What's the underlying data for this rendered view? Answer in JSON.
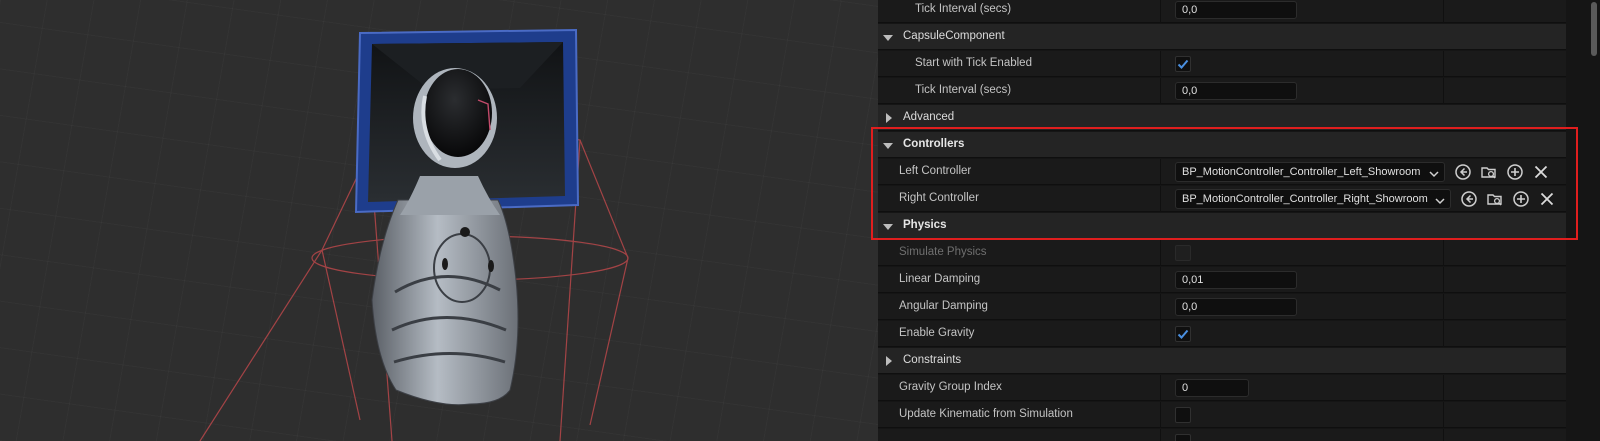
{
  "details": {
    "rows": [
      {
        "id": "tick-interval-1",
        "label": "Tick Interval (secs)",
        "type": "number",
        "value": "0,0"
      },
      {
        "id": "capsule",
        "label": "CapsuleComponent",
        "type": "category",
        "expanded": true
      },
      {
        "id": "start-tick",
        "label": "Start with Tick Enabled",
        "type": "checkbox",
        "checked": true
      },
      {
        "id": "tick-interval-2",
        "label": "Tick Interval (secs)",
        "type": "number",
        "value": "0,0"
      },
      {
        "id": "advanced",
        "label": "Advanced",
        "type": "category",
        "expanded": false
      },
      {
        "id": "controllers",
        "label": "Controllers",
        "type": "category",
        "expanded": true
      },
      {
        "id": "left-controller",
        "label": "Left Controller",
        "type": "asset",
        "value": "BP_MotionController_Controller_Left_Showroom"
      },
      {
        "id": "right-controller",
        "label": "Right Controller",
        "type": "asset",
        "value": "BP_MotionController_Controller_Right_Showroom"
      },
      {
        "id": "physics",
        "label": "Physics",
        "type": "category",
        "expanded": true
      },
      {
        "id": "simulate-physics",
        "label": "Simulate Physics",
        "type": "checkbox",
        "checked": false,
        "disabled": true
      },
      {
        "id": "linear-damping",
        "label": "Linear Damping",
        "type": "number",
        "value": "0,01"
      },
      {
        "id": "angular-damping",
        "label": "Angular Damping",
        "type": "number",
        "value": "0,0"
      },
      {
        "id": "enable-gravity",
        "label": "Enable Gravity",
        "type": "checkbox",
        "checked": true
      },
      {
        "id": "constraints",
        "label": "Constraints",
        "type": "category",
        "expanded": false
      },
      {
        "id": "gravity-group",
        "label": "Gravity Group Index",
        "type": "number",
        "value": "0"
      },
      {
        "id": "update-kinematic",
        "label": "Update Kinematic from Simulation",
        "type": "checkbox",
        "checked": false
      },
      {
        "id": "partial-row",
        "label": "",
        "type": "checkbox",
        "checked": false
      }
    ]
  },
  "icons": {
    "browse": "browse-asset-icon",
    "find": "find-in-content-browser-icon",
    "add": "add-icon",
    "clear": "clear-icon",
    "chevron": "chevron-down-icon"
  },
  "colors": {
    "highlight": "#e01e1e",
    "check": "#4a8fe0",
    "monitor_frame": "#1e3d8c"
  }
}
